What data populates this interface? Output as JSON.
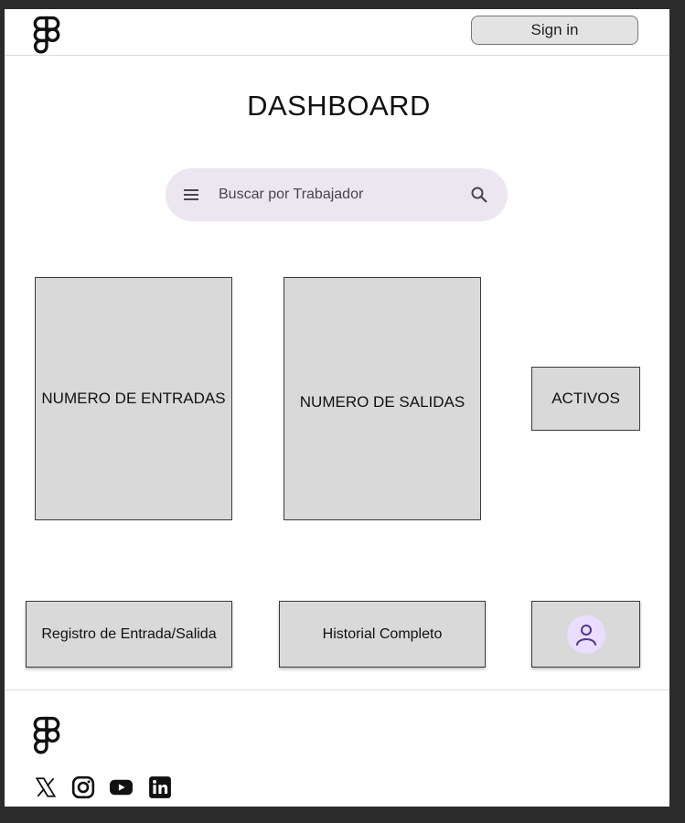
{
  "header": {
    "logo_icon": "figma-logo-icon",
    "signin_label": "Sign in"
  },
  "page": {
    "title": "DASHBOARD"
  },
  "search": {
    "placeholder": "Buscar por Trabajador",
    "menu_icon": "hamburger-menu-icon",
    "search_icon": "search-icon"
  },
  "cards": {
    "entradas": "NUMERO DE ENTRADAS",
    "salidas": "NUMERO DE SALIDAS",
    "activos": "ACTIVOS"
  },
  "actions": {
    "registro": "Registro de Entrada/Salida",
    "historial": "Historial Completo",
    "profile_icon": "user-avatar-icon"
  },
  "footer": {
    "logo_icon": "figma-logo-icon",
    "social_icons": [
      "x-twitter-icon",
      "instagram-icon",
      "youtube-icon",
      "linkedin-icon"
    ]
  },
  "colors": {
    "search_bg": "#ece6f0",
    "card_bg": "#d9d9d9",
    "avatar_bg": "#eaddff",
    "avatar_fg": "#4f378a",
    "page_bg": "#2b2b2b"
  }
}
